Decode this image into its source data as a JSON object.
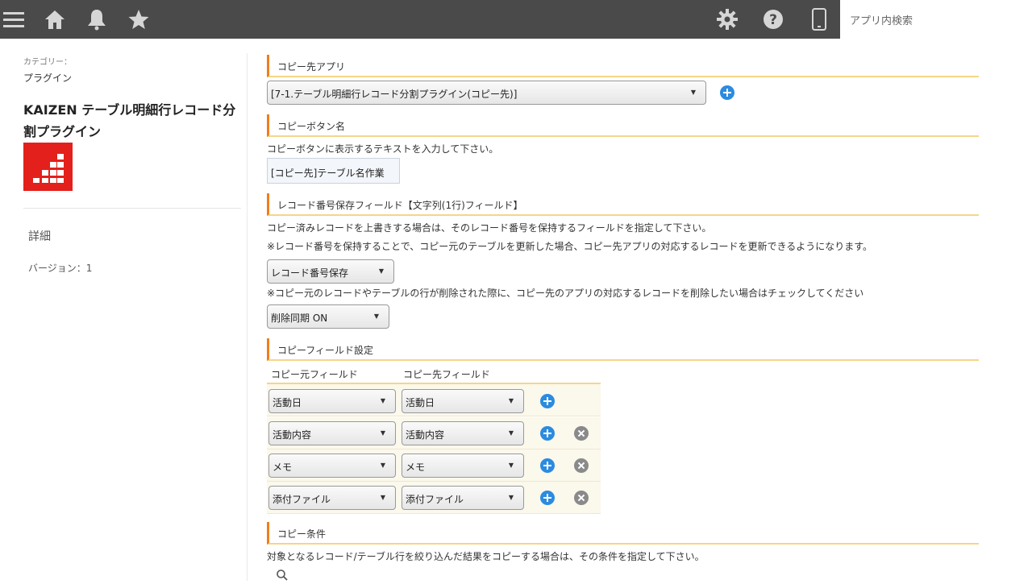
{
  "topbar": {
    "icons": [
      "menu-icon",
      "home-icon",
      "bell-icon",
      "star-icon",
      "gear-icon",
      "help-icon",
      "mobile-icon"
    ],
    "search_placeholder": "アプリ内検索"
  },
  "sidebar": {
    "category_label": "カテゴリー：",
    "category_value": "プラグイン",
    "plugin_title": "KAIZEN テーブル明細行レコード分割プラグイン",
    "details": "詳細",
    "version": "バージョン：1",
    "logo_color": "#e3201b"
  },
  "main": {
    "dest_app": {
      "heading": "コピー先アプリ",
      "selected": "[7-1.テーブル明細行レコード分割プラグイン(コピー先)]"
    },
    "copy_button": {
      "heading": "コピーボタン名",
      "description": "コピーボタンに表示するテキストを入力して下さい。",
      "value": "[コピー先]テーブル名作業"
    },
    "record_field": {
      "heading": "レコード番号保存フィールド【文字列(1行)フィールド】",
      "description1": "コピー済みレコードを上書きする場合は、そのレコード番号を保持するフィールドを指定して下さい。",
      "description2": "※レコード番号を保持することで、コピー元のテーブルを更新した場合、コピー先アプリの対応するレコードを更新できるようになります。",
      "selected": "レコード番号保存",
      "description3": "※コピー元のレコードやテーブルの行が削除された際に、コピー先のアプリの対応するレコードを削除したい場合はチェックしてください",
      "sync_selected": "削除同期 ON"
    },
    "field_settings": {
      "heading": "コピーフィールド設定",
      "col_source": "コピー元フィールド",
      "col_dest": "コピー先フィールド",
      "rows": [
        {
          "source": "活動日",
          "dest": "活動日"
        },
        {
          "source": "活動内容",
          "dest": "活動内容"
        },
        {
          "source": "メモ",
          "dest": "メモ"
        },
        {
          "source": "添付ファイル",
          "dest": "添付ファイル"
        }
      ]
    },
    "conditions": {
      "heading": "コピー条件",
      "description": "対象となるレコード/テーブル行を絞り込んだ結果をコピーする場合は、その条件を指定して下さい。"
    },
    "accent_color": "#f07e1a",
    "add_color": "#2b8be0"
  }
}
